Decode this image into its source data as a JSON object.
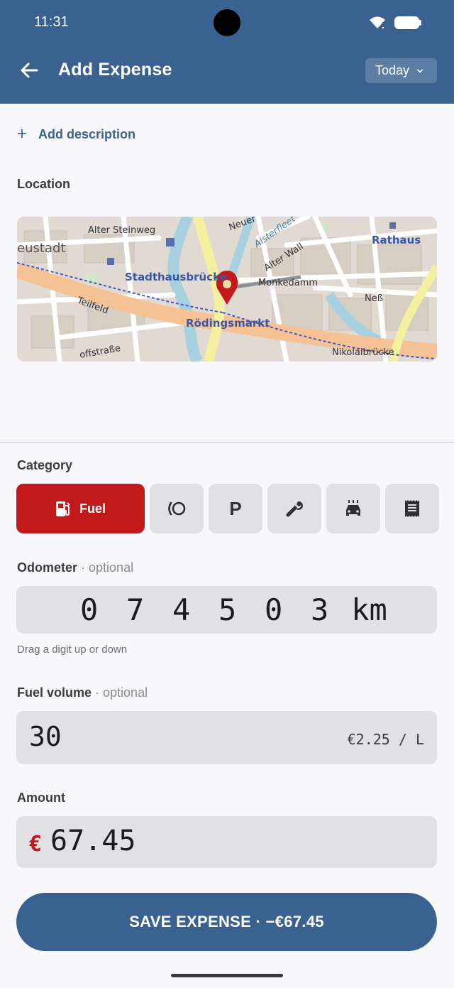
{
  "status_bar": {
    "time": "11:31"
  },
  "header": {
    "title": "Add Expense",
    "date_label": "Today"
  },
  "description": {
    "add_label": "Add description"
  },
  "location": {
    "label": "Location",
    "map_labels": {
      "alter_steinweg": "Alter Steinweg",
      "neustadt": "eustadt",
      "stadthausbruecke": "Stadthausbrücke",
      "roedingsmarkt": "Rödingsmarkt",
      "rathaus": "Rathaus",
      "monkedamm": "Monkedamm",
      "alter_wall": "Alter Wall",
      "nikolaibruecke": "Nikolaibrücke",
      "ness": "Neß",
      "teilfeld": "Teilfeld",
      "hopfenstrasse": "offstraße",
      "neuer": "Neuer",
      "alster": "Alsterfleet"
    }
  },
  "category": {
    "label": "Category",
    "selected": "Fuel",
    "items": [
      {
        "icon": "fuel-pump-icon",
        "label": "Fuel"
      },
      {
        "icon": "tire-icon",
        "label": ""
      },
      {
        "icon": "parking-icon",
        "label": "",
        "glyph": "P"
      },
      {
        "icon": "wrench-icon",
        "label": ""
      },
      {
        "icon": "car-wash-icon",
        "label": ""
      },
      {
        "icon": "receipt-icon",
        "label": ""
      }
    ]
  },
  "odometer": {
    "label": "Odometer",
    "optional": " · optional",
    "digits": [
      "0",
      "7",
      "4",
      "5",
      "0",
      "3"
    ],
    "unit": "km",
    "hint": "Drag a digit up or down"
  },
  "fuel_volume": {
    "label": "Fuel volume",
    "optional": " · optional",
    "value": "30",
    "price_per_unit": "€2.25 / L"
  },
  "amount": {
    "label": "Amount",
    "currency": "€",
    "value": "67.45"
  },
  "save_button": {
    "label": "SAVE EXPENSE · −€67.45"
  },
  "colors": {
    "primary": "#3a6291",
    "accent_red": "#c21a1a",
    "surface": "#e0e0e5",
    "background": "#f8f8fc"
  }
}
